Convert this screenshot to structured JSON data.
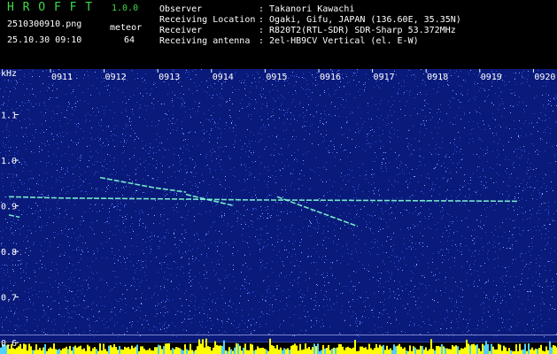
{
  "app": {
    "name": "H R O F F T",
    "version": "1.0.0",
    "filename": "2510300910.png",
    "datetime": "25.10.30 09:10",
    "meteor_label": "meteor",
    "meteor_count": "64"
  },
  "info": {
    "observer_label": "Observer",
    "observer": ": Takanori Kawachi",
    "location_label": "Receiving Location",
    "location": ": Ogaki, Gifu, JAPAN (136.60E, 35.35N)",
    "receiver_label": "Receiver",
    "receiver": ": R820T2(RTL-SDR) SDR-Sharp 53.372MHz",
    "antenna_label": "Receiving antenna",
    "antenna": ": 2el-HB9CV Vertical (el. E-W)"
  },
  "colors": {
    "background": "#000000",
    "spectrum_bg": "#0a1a7a",
    "header_green": "#3fd94a",
    "text": "#ffffff",
    "meteor_trace": "#7fffd0",
    "signal_bar": "#ffff00"
  },
  "chart_data": {
    "type": "heatmap",
    "ylabel": "kHz",
    "x_ticks": [
      "0911",
      "0912",
      "0913",
      "0914",
      "0915",
      "0916",
      "0917",
      "0918",
      "0919",
      "0920"
    ],
    "y_ticks": [
      "1.1",
      "1.0",
      "0.9",
      "0.8",
      "0.7",
      "0.6"
    ],
    "ylim": [
      0.575,
      1.2
    ],
    "xlim": [
      "09:10",
      "09:20"
    ],
    "traces": [
      {
        "name": "",
        "points": [
          [
            0.0,
            0.92
          ],
          [
            1.0,
            0.917
          ],
          [
            3.0,
            0.915
          ],
          [
            4.5,
            0.913
          ],
          [
            6.5,
            0.912
          ],
          [
            9.5,
            0.91
          ]
        ]
      },
      {
        "name": "",
        "points": [
          [
            1.7,
            0.962
          ],
          [
            2.7,
            0.94
          ],
          [
            3.3,
            0.93
          ]
        ]
      },
      {
        "name": "",
        "points": [
          [
            3.3,
            0.925
          ],
          [
            4.2,
            0.9
          ]
        ]
      },
      {
        "name": "",
        "points": [
          [
            5.0,
            0.92
          ],
          [
            6.5,
            0.855
          ]
        ]
      },
      {
        "name": "",
        "points": [
          [
            0.0,
            0.88
          ],
          [
            0.2,
            0.875
          ]
        ]
      }
    ],
    "reference_lines": [
      0.617,
      0.6
    ]
  }
}
